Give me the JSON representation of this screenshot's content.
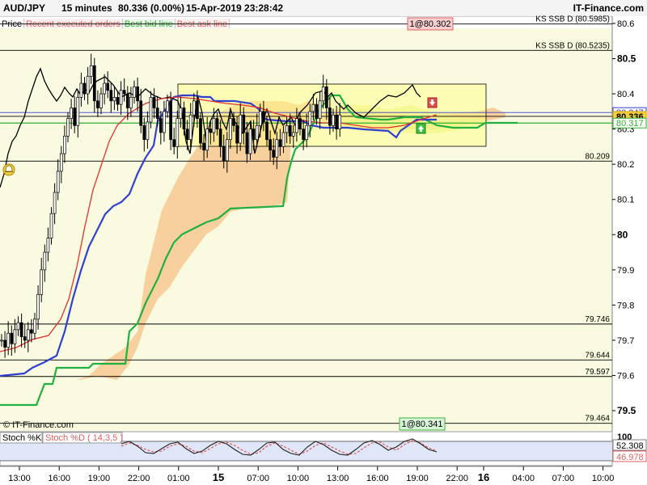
{
  "header": {
    "symbol": "AUD/JPY",
    "timeframe": "15 minutes",
    "last": "80.336 (0.00%)",
    "datetime": "15-Apr-2019 23:28:42",
    "brand": "IT-Finance.com"
  },
  "legend": [
    {
      "label": "Price",
      "color": "#000000"
    },
    {
      "label": "Recent executed orders",
      "color": "#e06060"
    },
    {
      "label": "Best bid line",
      "color": "#30b030"
    },
    {
      "label": "Best ask line",
      "color": "#e06060"
    }
  ],
  "annotations": {
    "ask_box": "1@80.302",
    "bid_box": "1@80.341",
    "watermark": "© IT-Finance.com"
  },
  "levels": [
    {
      "label": "KS SSB D (80.5985)",
      "value": 80.5985,
      "side": "right-top"
    },
    {
      "label": "KS SSB D (80.5235)",
      "value": 80.5235,
      "side": "right-top"
    },
    {
      "label": "80.209",
      "value": 80.209,
      "side": "left"
    },
    {
      "label": "79.746",
      "value": 79.746,
      "side": "left"
    },
    {
      "label": "79.644",
      "value": 79.644,
      "side": "left"
    },
    {
      "label": "79.597",
      "value": 79.597,
      "side": "left"
    },
    {
      "label": "79.464",
      "value": 79.464,
      "side": "left"
    }
  ],
  "price_tags": [
    {
      "label": "80.347",
      "color": "#3040d0"
    },
    {
      "label": "80.336",
      "color": "#e0a000"
    },
    {
      "label": "80.317",
      "color": "#30b030"
    }
  ],
  "stoch": {
    "label_k": "Stoch %K",
    "label_d": "Stoch %D ( 14,3,5 )",
    "k_value": "52.308",
    "d_value": "46.978",
    "top_tick": "100"
  },
  "chart_data": {
    "type": "line",
    "instrument": "AUD/JPY",
    "y_ticks": [
      "80.6",
      "80.5",
      "80.4",
      "80.3",
      "80.2",
      "80.1",
      "80",
      "79.9",
      "79.8",
      "79.7",
      "79.6",
      "79.5"
    ],
    "y_tick_values": [
      80.6,
      80.5,
      80.4,
      80.3,
      80.2,
      80.1,
      80.0,
      79.9,
      79.8,
      79.7,
      79.6,
      79.5
    ],
    "ylim": [
      79.43,
      80.67
    ],
    "x_tick_labels": [
      "13:00",
      "16:00",
      "19:00",
      "22:00",
      "01:00",
      "15",
      "07:00",
      "10:00",
      "13:00",
      "16:00",
      "19:00",
      "22:00",
      "16",
      "04:00",
      "07:00",
      "10:00"
    ],
    "x_tick_bars": [
      0,
      12,
      24,
      36,
      48,
      60,
      72,
      84,
      96,
      108,
      120,
      132,
      140,
      152,
      164,
      176
    ],
    "bars_total": 184,
    "bars_observed": 135,
    "close_series": [
      79.7,
      79.68,
      79.72,
      79.69,
      79.73,
      79.75,
      79.71,
      79.7,
      79.73,
      79.72,
      79.76,
      79.83,
      79.9,
      79.95,
      79.99,
      80.06,
      80.12,
      80.18,
      80.23,
      80.28,
      80.33,
      80.36,
      80.31,
      80.39,
      80.43,
      80.4,
      80.45,
      80.48,
      80.38,
      80.36,
      80.4,
      80.43,
      80.41,
      80.38,
      80.39,
      80.37,
      80.41,
      80.4,
      80.36,
      80.39,
      80.42,
      80.38,
      80.31,
      80.27,
      80.32,
      80.39,
      80.36,
      80.33,
      80.29,
      80.35,
      80.38,
      80.27,
      80.25,
      80.33,
      80.36,
      80.3,
      80.27,
      80.34,
      80.38,
      80.33,
      80.26,
      80.24,
      80.3,
      80.29,
      80.33,
      80.3,
      80.25,
      80.21,
      80.27,
      80.33,
      80.31,
      80.26,
      80.34,
      80.29,
      80.23,
      80.3,
      80.27,
      80.31,
      80.35,
      80.32,
      80.27,
      80.24,
      80.22,
      80.27,
      80.25,
      80.29,
      80.31,
      80.28,
      80.29,
      80.33,
      80.3,
      80.27,
      80.31,
      80.35,
      80.37,
      80.33,
      80.38,
      80.42,
      80.36,
      80.31,
      80.34,
      80.3,
      80.34
    ]
  }
}
